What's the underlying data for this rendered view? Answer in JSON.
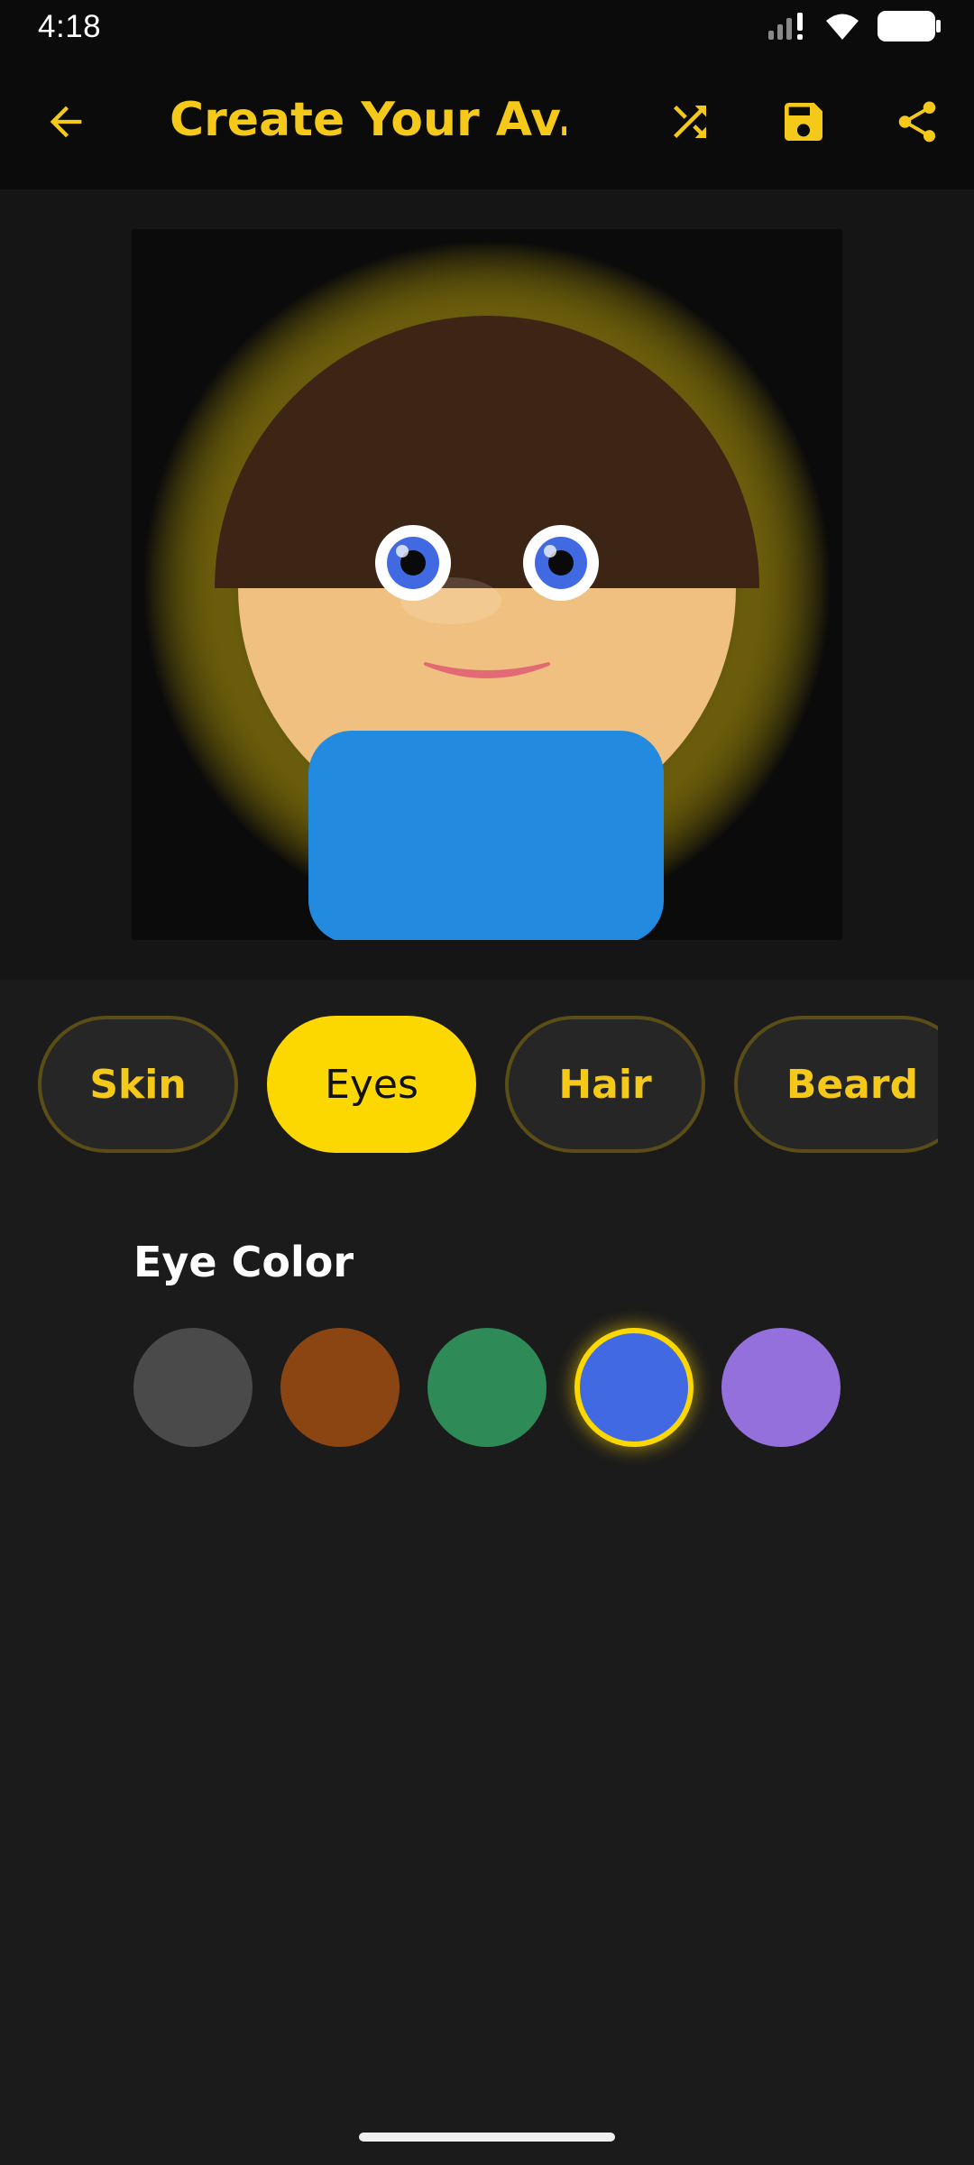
{
  "status_bar": {
    "time": "4:18",
    "icons": [
      "signal-icon",
      "wifi-icon",
      "battery-icon"
    ]
  },
  "app_bar": {
    "title": "Create Your Av...",
    "back_icon": "arrow-left-icon",
    "actions": [
      "shuffle-icon",
      "save-icon",
      "share-icon"
    ],
    "accent_color": "#f4c91a"
  },
  "avatar": {
    "skin_color": "#efc07f",
    "hair_color": "#3d2516",
    "eye_color": "#4169e1",
    "shirt_color": "#228be0",
    "glow_color": "#fcd800"
  },
  "tabs": {
    "items": [
      {
        "label": "Skin"
      },
      {
        "label": "Eyes"
      },
      {
        "label": "Hair"
      },
      {
        "label": "Beard"
      }
    ],
    "selected": "Eyes"
  },
  "eye_color_section": {
    "title": "Eye Color",
    "swatches": [
      {
        "name": "gray",
        "color": "#4a4a4a"
      },
      {
        "name": "brown",
        "color": "#8b4513"
      },
      {
        "name": "green",
        "color": "#2e8b57"
      },
      {
        "name": "blue",
        "color": "#4169e1"
      },
      {
        "name": "purple",
        "color": "#9370db"
      }
    ],
    "selected": "blue"
  }
}
